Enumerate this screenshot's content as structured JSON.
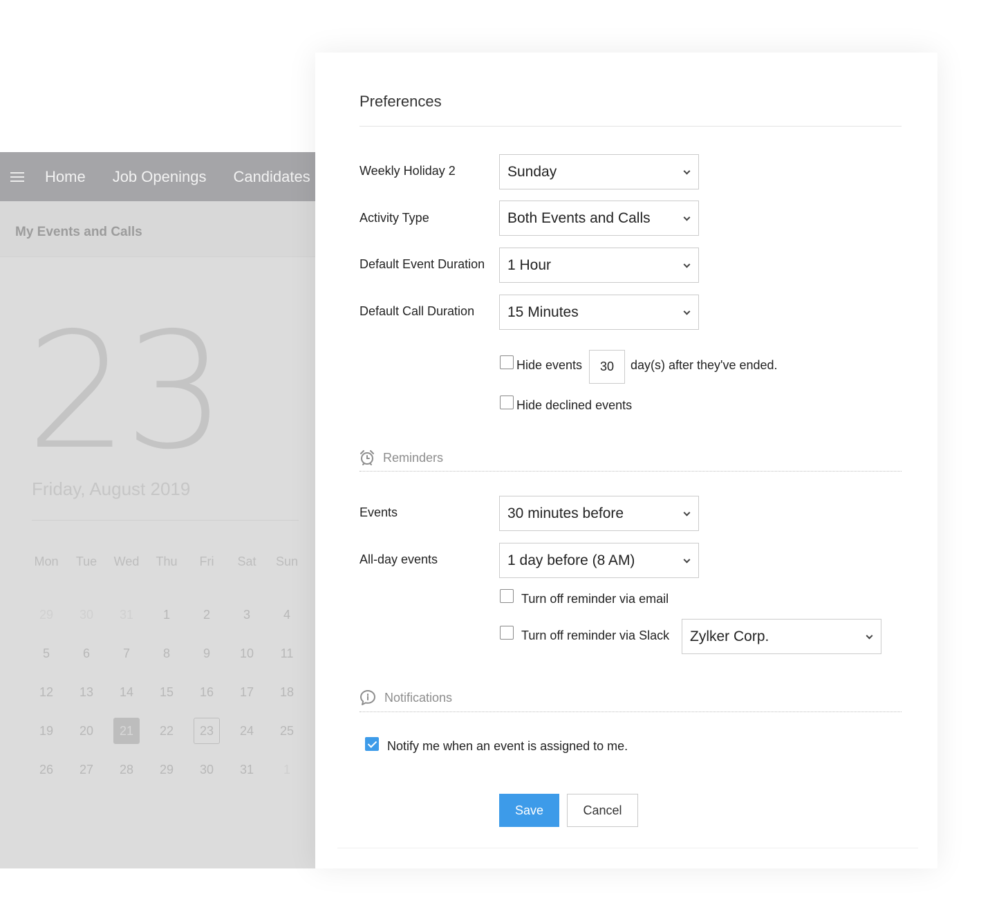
{
  "background_app": {
    "nav": {
      "home": "Home",
      "job_openings": "Job Openings",
      "candidates": "Candidates"
    },
    "subheader_title": "My Events and Calls",
    "big_day": "23",
    "date_subtitle": "Friday, August 2019",
    "weekdays": [
      "Mon",
      "Tue",
      "Wed",
      "Thu",
      "Fri",
      "Sat",
      "Sun"
    ],
    "calendar_days": [
      "29",
      "30",
      "31",
      "1",
      "2",
      "3",
      "4",
      "5",
      "6",
      "7",
      "8",
      "9",
      "10",
      "11",
      "12",
      "13",
      "14",
      "15",
      "16",
      "17",
      "18",
      "19",
      "20",
      "21",
      "22",
      "23",
      "24",
      "25",
      "26",
      "27",
      "28",
      "29",
      "30",
      "31",
      "1"
    ],
    "selected_day": "21",
    "today": "23"
  },
  "preferences": {
    "title": "Preferences",
    "weekly_holiday_label": "Weekly Holiday 2",
    "weekly_holiday_value": "Sunday",
    "activity_type_label": "Activity Type",
    "activity_type_value": "Both Events and Calls",
    "event_duration_label": "Default Event Duration",
    "event_duration_value": "1 Hour",
    "call_duration_label": "Default Call Duration",
    "call_duration_value": "15 Minutes",
    "hide_events_label": "Hide events",
    "hide_events_days": "30",
    "hide_events_suffix": "day(s) after they've ended.",
    "hide_events_checked": false,
    "hide_declined_label": "Hide declined events",
    "hide_declined_checked": false
  },
  "reminders": {
    "heading": "Reminders",
    "events_label": "Events",
    "events_value": "30 minutes before",
    "allday_label": "All-day events",
    "allday_value": "1 day before (8 AM)",
    "email_off_label": "Turn off reminder via email",
    "email_off_checked": false,
    "slack_off_label": "Turn off reminder via Slack",
    "slack_off_checked": false,
    "slack_workspace": "Zylker Corp."
  },
  "notifications": {
    "heading": "Notifications",
    "notify_assigned_label": "Notify me when an event is assigned to me.",
    "notify_assigned_checked": true
  },
  "actions": {
    "save": "Save",
    "cancel": "Cancel"
  },
  "colors": {
    "accent": "#3d9be9",
    "nav_bg": "#a5a5a8",
    "backdrop": "#dcdcdc"
  }
}
